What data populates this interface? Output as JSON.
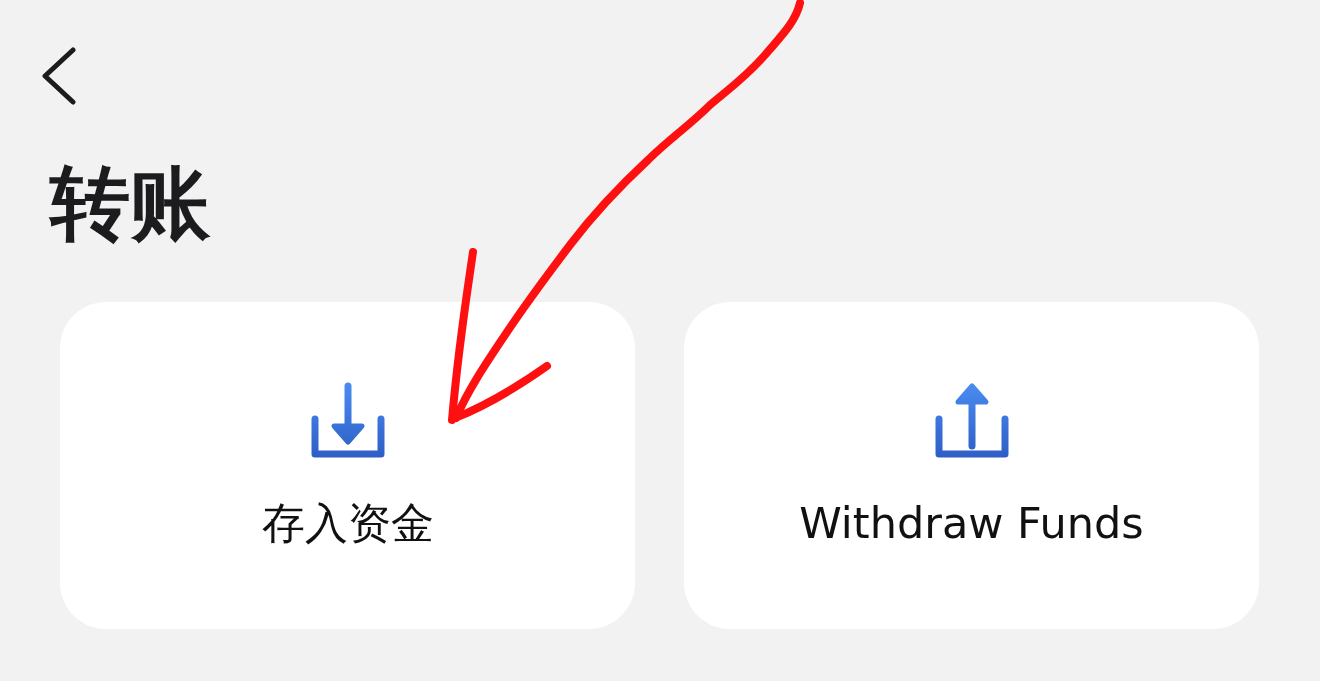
{
  "title": "转账",
  "actions": [
    {
      "label": "存入资金",
      "kind": "deposit"
    },
    {
      "label": "Withdraw Funds",
      "kind": "withdraw"
    }
  ]
}
